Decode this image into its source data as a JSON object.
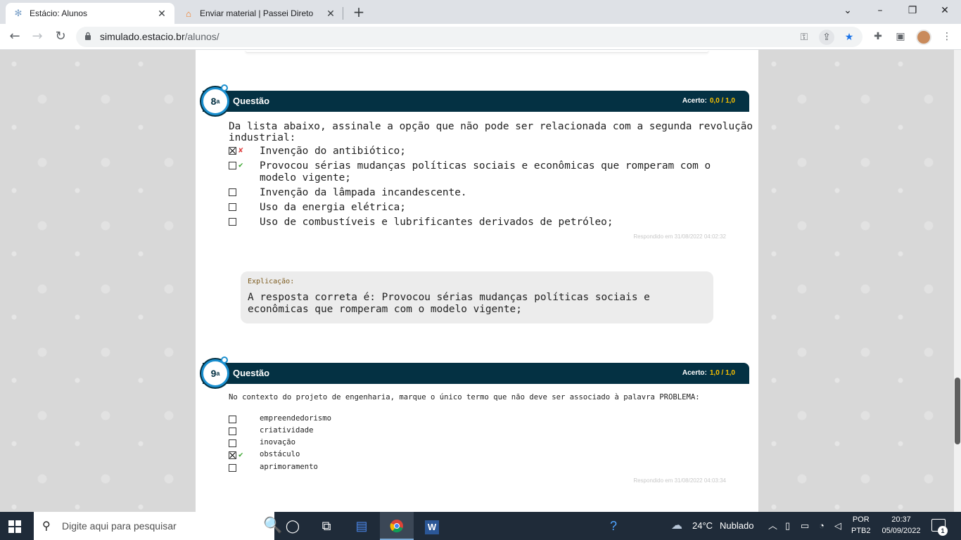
{
  "browser": {
    "tabs": [
      {
        "title": "Estácio: Alunos",
        "icon": "globe-icon"
      },
      {
        "title": "Enviar material | Passei Direto",
        "icon": "graduation-cap-icon"
      }
    ],
    "url_host": "simulado.estacio.br",
    "url_path": "/alunos/"
  },
  "questions": [
    {
      "number": "8",
      "number_suffix": "a",
      "label": "Questão",
      "score_label": "Acerto:",
      "score_value": "0,0  / 1,0",
      "prompt": "Da lista abaixo, assinale a opção que não pode ser relacionada com a segunda revolução industrial:",
      "options": [
        {
          "text": "Invenção do antibiótico;",
          "checked": true,
          "mark": "wrong"
        },
        {
          "text": "Provocou sérias mudanças políticas sociais e econômicas que romperam com o modelo vigente;",
          "checked": false,
          "mark": "right"
        },
        {
          "text": "Invenção da lâmpada incandescente.",
          "checked": false,
          "mark": ""
        },
        {
          "text": "Uso da energia elétrica;",
          "checked": false,
          "mark": ""
        },
        {
          "text": "Uso de combustíveis e lubrificantes derivados de petróleo;",
          "checked": false,
          "mark": ""
        }
      ],
      "answered_at": "Respondido em 31/08/2022 04:02:32",
      "explanation_label": "Explicação:",
      "explanation_text": "A resposta correta é: Provocou sérias mudanças políticas sociais e econômicas que romperam com o modelo vigente;"
    },
    {
      "number": "9",
      "number_suffix": "a",
      "label": "Questão",
      "score_label": "Acerto:",
      "score_value": "1,0  / 1,0",
      "prompt": "No contexto do projeto de engenharia, marque o único termo que não deve ser associado à palavra PROBLEMA:",
      "options": [
        {
          "text": "empreendedorismo",
          "checked": false,
          "mark": ""
        },
        {
          "text": "criatividade",
          "checked": false,
          "mark": ""
        },
        {
          "text": "inovação",
          "checked": false,
          "mark": ""
        },
        {
          "text": "obstáculo",
          "checked": true,
          "mark": "right"
        },
        {
          "text": "aprimoramento",
          "checked": false,
          "mark": ""
        }
      ],
      "answered_at": "Respondido em 31/08/2022 04:03:34"
    }
  ],
  "taskbar": {
    "search_placeholder": "Digite aqui para pesquisar",
    "weather_temp": "24°C",
    "weather_desc": "Nublado",
    "lang_top": "POR",
    "lang_bottom": "PTB2",
    "time": "20:37",
    "date": "05/09/2022",
    "notifications": "1"
  },
  "colors": {
    "question_bar": "#043143",
    "score_value": "#f7c000",
    "wrong": "#e04646",
    "right": "#3aa52f"
  }
}
